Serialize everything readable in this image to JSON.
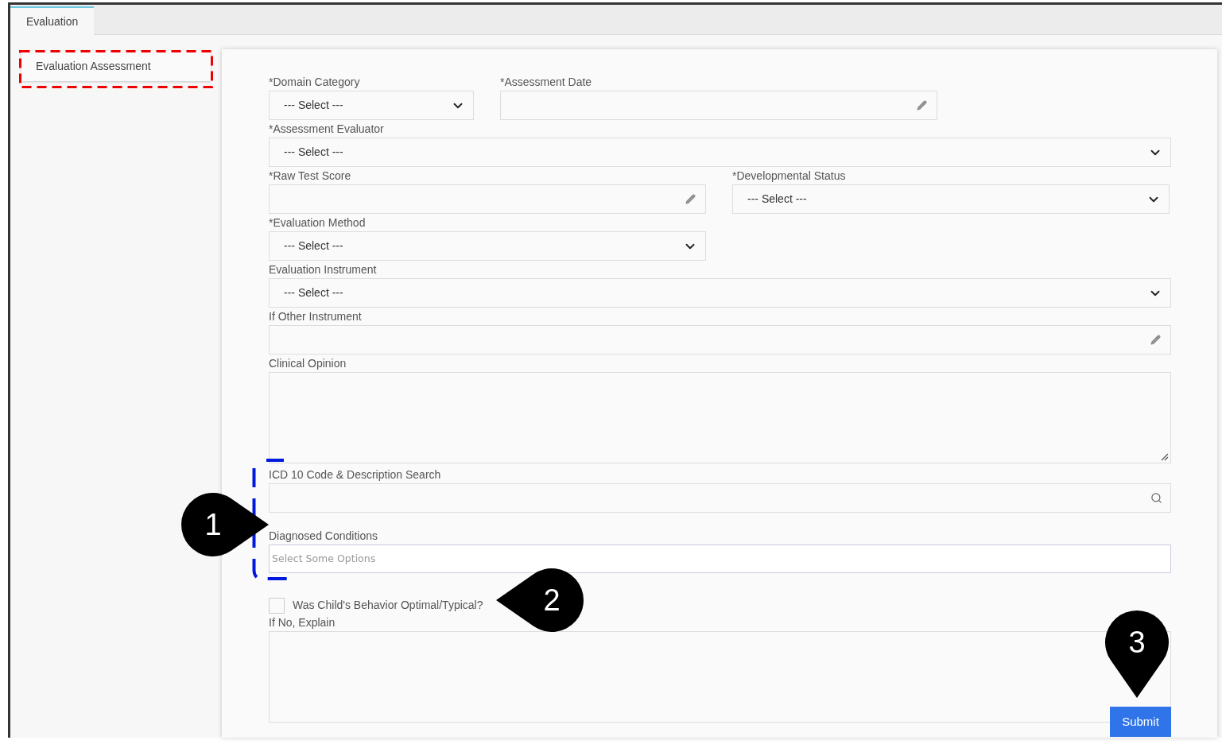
{
  "tabs": [
    {
      "label": "Evaluation",
      "selected": true
    }
  ],
  "sidebar": {
    "items": [
      {
        "label": "Evaluation Assessment",
        "selected": true
      }
    ]
  },
  "form": {
    "rows": [
      {
        "fields": [
          {
            "kind": "select",
            "label": "*Domain Category",
            "value": "--- Select ---"
          },
          {
            "kind": "text",
            "label": "*Assessment Date"
          }
        ]
      },
      {
        "fields": [
          {
            "kind": "select",
            "label": "*Assessment Evaluator",
            "value": "--- Select ---"
          }
        ]
      },
      {
        "fields": [
          {
            "kind": "text",
            "label": "*Raw Test Score"
          },
          {
            "kind": "select",
            "label": "*Developmental Status",
            "value": "--- Select ---"
          }
        ]
      },
      {
        "fields": [
          {
            "kind": "select",
            "label": "*Evaluation Method",
            "value": "--- Select ---"
          }
        ]
      },
      {
        "fields": [
          {
            "kind": "select",
            "label": "Evaluation Instrument",
            "value": "--- Select ---"
          }
        ]
      },
      {
        "fields": [
          {
            "kind": "text",
            "label": "If Other Instrument"
          }
        ]
      },
      {
        "fields": [
          {
            "kind": "textarea",
            "label": "Clinical Opinion"
          }
        ]
      },
      {
        "fields": [
          {
            "kind": "search",
            "label": "ICD 10 Code & Description Search"
          }
        ]
      },
      {
        "fields": [
          {
            "kind": "multiselect",
            "label": "Diagnosed Conditions",
            "placeholder": "Select Some Options"
          }
        ]
      },
      {
        "fields": [
          {
            "kind": "checkbox",
            "label": "Was Child's Behavior Optimal/Typical?",
            "checked": false
          }
        ]
      },
      {
        "fields": [
          {
            "kind": "textarea",
            "label": "If No, Explain"
          }
        ]
      }
    ]
  },
  "submit_button": {
    "label": "Submit"
  },
  "callouts": [
    {
      "number": "1"
    },
    {
      "number": "2"
    },
    {
      "number": "3"
    }
  ]
}
